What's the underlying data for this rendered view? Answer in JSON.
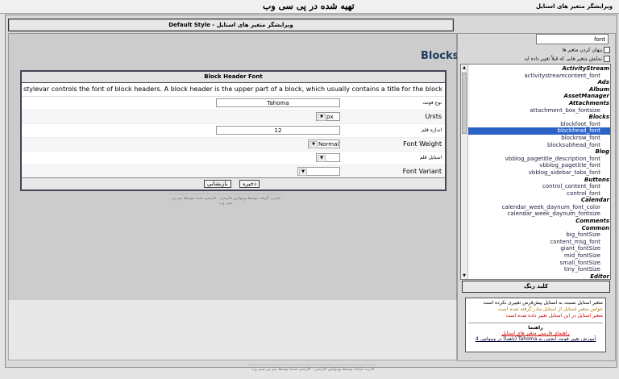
{
  "topbar": {
    "brand": "تهیه شده در پی سی وب",
    "app_title": "ویرایشگر متغیر های استایل"
  },
  "header": {
    "title": "ویرایشگر متغیر های استایل - Default Style"
  },
  "main": {
    "heading": "Blocks",
    "form": {
      "title": "Block Header Font",
      "description": "This stylevar controls the font of block headers. A block header is the upper part of a block, which usually contains a title for the block.",
      "fields": [
        {
          "label": "نوع فونت",
          "value": "Tahoma"
        },
        {
          "label": "Units",
          "value": "px"
        },
        {
          "label": "اندازه قلم",
          "value": "12"
        },
        {
          "label": "Font Weight",
          "value": "Normal"
        },
        {
          "label": "استایل قلم",
          "value": ""
        },
        {
          "label": "Font Variant",
          "value": ""
        }
      ],
      "save_label": "ذخیره",
      "reset_label": "بازنشانی"
    },
    "footer_text": "قدرت گرفته توسط ویبولتین فارسی - فارسی شده توسط تیم پی سی وب"
  },
  "sidebar": {
    "search_value": "font",
    "checkbox1": "پنهان کردن متغیر ها",
    "checkbox2": "نمایش متغیر هایی که قبلاً تغییر داده اید",
    "items": [
      {
        "label": "ActivityStream",
        "group": true
      },
      {
        "label": "activitystreamcontent_font",
        "group": false
      },
      {
        "label": "Ads",
        "group": true
      },
      {
        "label": "Album",
        "group": true
      },
      {
        "label": "AssetManager",
        "group": true
      },
      {
        "label": "Attachments",
        "group": true
      },
      {
        "label": "attachment_box_fontsize",
        "group": false
      },
      {
        "label": "Blocks",
        "group": true
      },
      {
        "label": "blockfoot_font",
        "group": false
      },
      {
        "label": "blockhead_font",
        "group": false,
        "selected": true
      },
      {
        "label": "blockrow_font",
        "group": false
      },
      {
        "label": "blocksubhead_font",
        "group": false
      },
      {
        "label": "Blog",
        "group": true
      },
      {
        "label": "vbblog_pagetitle_description_font",
        "group": false
      },
      {
        "label": "vbblog_pagetitle_font",
        "group": false
      },
      {
        "label": "vbblog_sidebar_tabs_font",
        "group": false
      },
      {
        "label": "Buttons",
        "group": true
      },
      {
        "label": "control_content_font",
        "group": false
      },
      {
        "label": "control_font",
        "group": false
      },
      {
        "label": "Calendar",
        "group": true
      },
      {
        "label": "calendar_week_daynum_font_color",
        "group": false
      },
      {
        "label": "calendar_week_daynum_fontsize",
        "group": false
      },
      {
        "label": "Comments",
        "group": true
      },
      {
        "label": "Common",
        "group": true
      },
      {
        "label": "big_fontSize",
        "group": false
      },
      {
        "label": "content_msg_font",
        "group": false
      },
      {
        "label": "giant_fontSize",
        "group": false
      },
      {
        "label": "mid_fontSize",
        "group": false
      },
      {
        "label": "small_fontSize",
        "group": false
      },
      {
        "label": "tiny_fontSize",
        "group": false
      },
      {
        "label": "Editor",
        "group": true
      }
    ],
    "color_key": {
      "title": "کلید رنگ",
      "line1": "متغیر استایل نسبت به استایل پیش‌فرض تغییری نکرده است",
      "line2": "خواص متغیر استایل از استایل مادر گرفته شده است",
      "line3": "متغیر استایل در این استایل تغییر داده شده است",
      "help_title": "راهنما",
      "help_link1": "راهنمای فارسی متغیر های استایل",
      "help_link2": "آموزش تغییر فونت انجمن به Tahoma (تاهما) در ویبولتین 4"
    }
  },
  "bottom_footer": "قدرت گرفته توسط ویبولتین فارسی - فارسی شده توسط تیم پی سی وب",
  "colors": {
    "selected": "#2b62c8",
    "line1": "#000000",
    "line2": "#b07000",
    "line3": "#d40000"
  }
}
